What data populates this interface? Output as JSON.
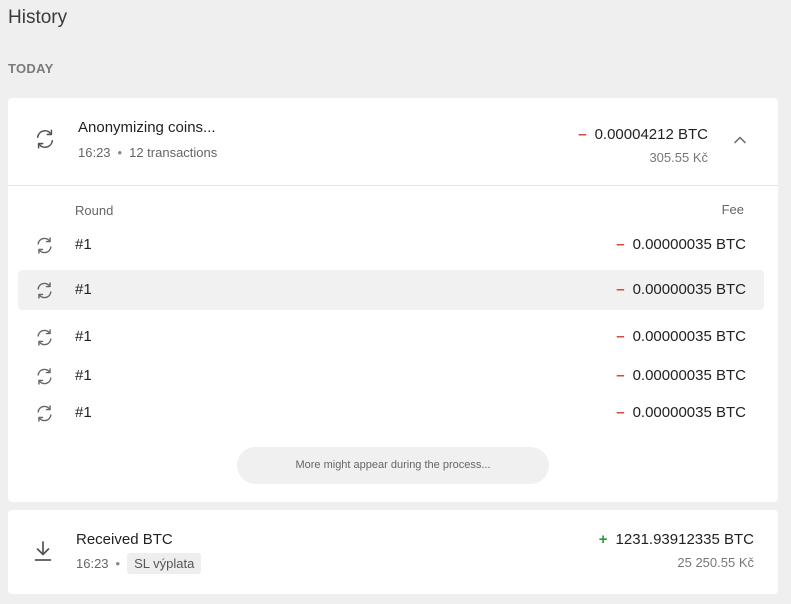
{
  "page": {
    "title": "History"
  },
  "section": {
    "label": "TODAY"
  },
  "coinjoin": {
    "icon": "refresh-icon",
    "title": "Anonymizing coins...",
    "time": "16:23",
    "transactions": "12 transactions",
    "amount_sign": "–",
    "amount": "0.00004212 BTC",
    "fiat": "305.55 Kč",
    "expanded": true,
    "columns": {
      "round": "Round",
      "fee": "Fee"
    },
    "rounds": [
      {
        "round": "#1",
        "fee_sign": "–",
        "fee": "0.00000035 BTC",
        "highlighted": false
      },
      {
        "round": "#1",
        "fee_sign": "–",
        "fee": "0.00000035 BTC",
        "highlighted": true
      },
      {
        "round": "#1",
        "fee_sign": "–",
        "fee": "0.00000035 BTC",
        "highlighted": false
      },
      {
        "round": "#1",
        "fee_sign": "–",
        "fee": "0.00000035 BTC",
        "highlighted": false
      },
      {
        "round": "#1",
        "fee_sign": "–",
        "fee": "0.00000035 BTC",
        "highlighted": false
      }
    ],
    "note": "More might appear during the process..."
  },
  "received": {
    "icon": "download-icon",
    "title": "Received BTC",
    "time": "16:23",
    "label": "SL výplata",
    "amount_sign": "+",
    "amount": "1231.93912335 BTC",
    "fiat": "25 250.55 Kč"
  },
  "colors": {
    "negative": "#d04a3a",
    "positive": "#2b9a3a",
    "background": "#efefef",
    "highlight_row": "#f1f1f1"
  }
}
